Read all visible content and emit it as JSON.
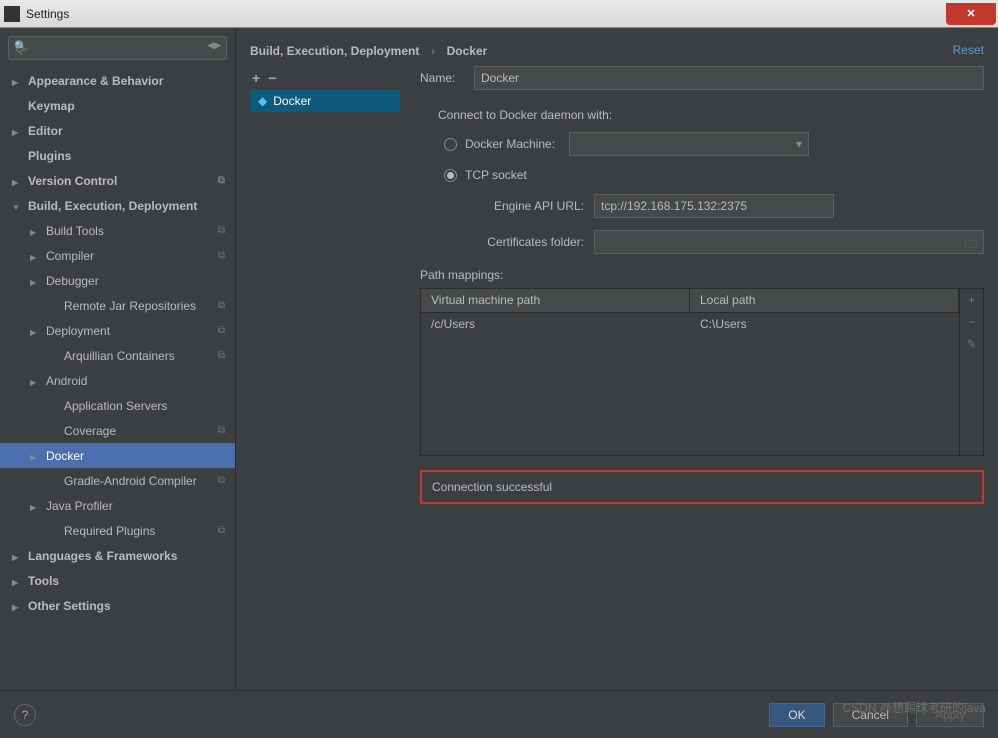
{
  "window": {
    "title": "Settings"
  },
  "search": {
    "placeholder": "Q-"
  },
  "tree": [
    {
      "label": "Appearance & Behavior",
      "bold": true,
      "arrow": "right",
      "ind": 0
    },
    {
      "label": "Keymap",
      "bold": true,
      "ind": 0,
      "spacer": true
    },
    {
      "label": "Editor",
      "bold": true,
      "arrow": "right",
      "ind": 0
    },
    {
      "label": "Plugins",
      "bold": true,
      "ind": 0,
      "spacer": true
    },
    {
      "label": "Version Control",
      "bold": true,
      "arrow": "right",
      "ind": 0,
      "copy": true
    },
    {
      "label": "Build, Execution, Deployment",
      "bold": true,
      "arrow": "down",
      "ind": 0
    },
    {
      "label": "Build Tools",
      "arrow": "right",
      "ind": 1,
      "copy": true
    },
    {
      "label": "Compiler",
      "arrow": "right",
      "ind": 1,
      "copy": true
    },
    {
      "label": "Debugger",
      "arrow": "right",
      "ind": 1
    },
    {
      "label": "Remote Jar Repositories",
      "ind": 2,
      "spacer": true,
      "copy": true
    },
    {
      "label": "Deployment",
      "arrow": "right",
      "ind": 1,
      "copy": true
    },
    {
      "label": "Arquillian Containers",
      "ind": 2,
      "spacer": true,
      "copy": true
    },
    {
      "label": "Android",
      "arrow": "right",
      "ind": 1
    },
    {
      "label": "Application Servers",
      "ind": 2,
      "spacer": true
    },
    {
      "label": "Coverage",
      "ind": 2,
      "spacer": true,
      "copy": true
    },
    {
      "label": "Docker",
      "arrow": "right",
      "ind": 1,
      "selected": true
    },
    {
      "label": "Gradle-Android Compiler",
      "ind": 2,
      "spacer": true,
      "copy": true
    },
    {
      "label": "Java Profiler",
      "arrow": "right",
      "ind": 1
    },
    {
      "label": "Required Plugins",
      "ind": 2,
      "spacer": true,
      "copy": true
    },
    {
      "label": "Languages & Frameworks",
      "bold": true,
      "arrow": "right",
      "ind": 0
    },
    {
      "label": "Tools",
      "bold": true,
      "arrow": "right",
      "ind": 0
    },
    {
      "label": "Other Settings",
      "bold": true,
      "arrow": "right",
      "ind": 0
    }
  ],
  "breadcrumb": {
    "a": "Build, Execution, Deployment",
    "b": "Docker",
    "reset": "Reset"
  },
  "list": {
    "item": "Docker"
  },
  "form": {
    "name_label": "Name:",
    "name_value": "Docker",
    "connect_label": "Connect to Docker daemon with:",
    "radio_machine": "Docker Machine:",
    "radio_tcp": "TCP socket",
    "url_label": "Engine API URL:",
    "url_value": "tcp://192.168.175.132:2375",
    "cert_label": "Certificates folder:",
    "paths_label": "Path mappings:",
    "col_vm": "Virtual machine path",
    "col_local": "Local path",
    "row_vm": "/c/Users",
    "row_local": "C:\\Users",
    "status": "Connection successful"
  },
  "buttons": {
    "ok": "OK",
    "cancel": "Cancel",
    "apply": "Apply",
    "help": "?"
  },
  "watermark": "CSDN @想踢球考研的java"
}
